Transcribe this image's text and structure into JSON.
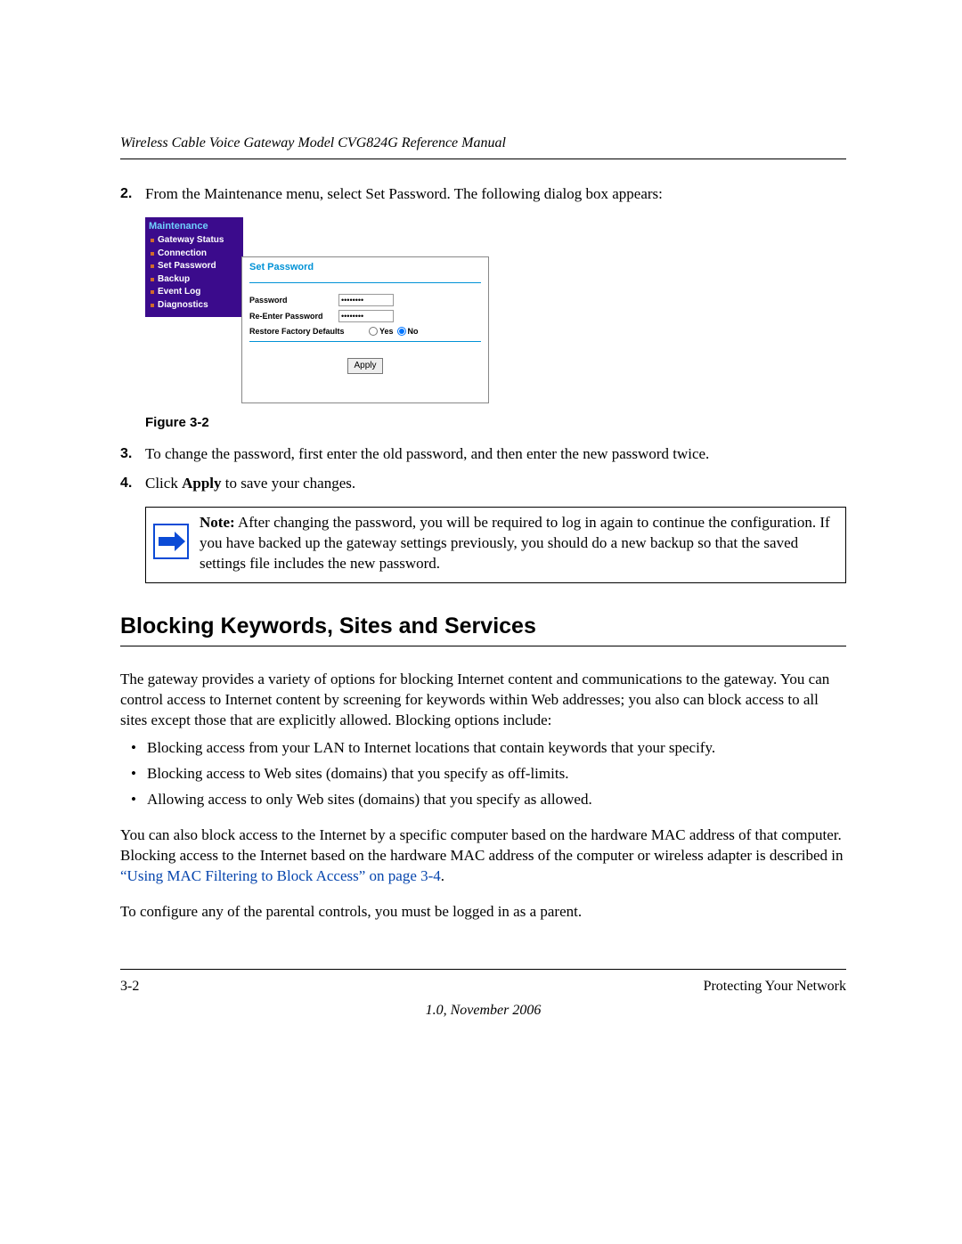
{
  "header": {
    "running_title": "Wireless Cable Voice Gateway Model CVG824G Reference Manual"
  },
  "steps": {
    "s2": {
      "num": "2.",
      "text": "From the Maintenance menu, select Set Password. The following dialog box appears:"
    },
    "s3": {
      "num": "3.",
      "text": "To change the password, first enter the old password, and then enter the new password twice."
    },
    "s4": {
      "num": "4.",
      "prefix": "Click ",
      "bold": "Apply",
      "suffix": " to save your changes."
    }
  },
  "figure": {
    "nav": {
      "title": "Maintenance",
      "items": [
        "Gateway Status",
        "Connection",
        "Set Password",
        "Backup",
        "Event Log",
        "Diagnostics"
      ]
    },
    "form": {
      "title": "Set Password",
      "password_label": "Password",
      "password_value": "••••••••",
      "reenter_label": "Re-Enter Password",
      "reenter_value": "••••••••",
      "restore_label": "Restore Factory Defaults",
      "yes": "Yes",
      "no": "No",
      "apply": "Apply"
    },
    "caption": "Figure 3-2"
  },
  "note": {
    "label": "Note:",
    "text": " After changing the password, you will be required to log in again to continue the configuration. If you have backed up the gateway settings previously, you should do a new backup so that the saved settings file includes the new password."
  },
  "section": {
    "title": "Blocking Keywords, Sites and Services",
    "p1": "The gateway provides a variety of options for blocking Internet content and communications to the gateway. You can control access to Internet content by screening for keywords within Web addresses; you also can block access to all sites except those that are explicitly allowed. Blocking options include:",
    "bullets": [
      "Blocking access from your LAN to Internet locations that contain keywords that your specify.",
      "Blocking access to Web sites (domains) that you specify as off-limits.",
      "Allowing access to only Web sites (domains) that you specify as allowed."
    ],
    "p2_pre": "You can also block access to the Internet by a specific computer based on the hardware MAC address of that computer. Blocking access to the Internet based on the hardware MAC address of the computer or wireless adapter is described in ",
    "p2_link": "“Using MAC Filtering to Block Access” on page 3-4",
    "p2_post": ".",
    "p3": "To configure any of the parental controls, you must be logged in as a parent."
  },
  "footer": {
    "page": "3-2",
    "title": "Protecting Your Network",
    "version": "1.0, November 2006"
  }
}
